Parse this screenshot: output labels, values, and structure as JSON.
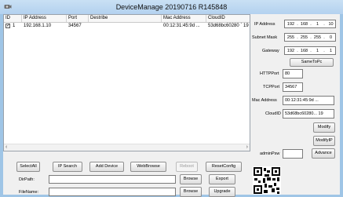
{
  "window": {
    "title": "DeviceManage 20190716 R145848"
  },
  "table": {
    "columns": [
      "ID",
      "IP Address",
      "Port",
      "Destribe",
      "Mac Address",
      "CloudID"
    ],
    "rows": [
      {
        "checked": true,
        "id": "1",
        "ip": "192.168.1.10",
        "port": "34567",
        "describe": "",
        "mac": "00:12:31:45:9d ...",
        "cloud": "53d68bc60280 ` 19"
      }
    ]
  },
  "settings": {
    "ip_label": "IP Address",
    "ip_octets": [
      "192",
      "168",
      "1",
      "10"
    ],
    "mask_label": "Subnet Mask",
    "mask_octets": [
      "255",
      "255",
      "255",
      "0"
    ],
    "gateway_label": "Gateway",
    "gateway_octets": [
      "192",
      "168",
      "1",
      "1"
    ],
    "same_to_pc": "SameToPc",
    "http_port_label": "HTTPPort",
    "http_port": "80",
    "tcp_port_label": "TCPPort",
    "tcp_port": "34567",
    "mac_label": "Mac Address",
    "mac": "00:12:31:45:9d ...",
    "cloud_label": "CloudID",
    "cloud": "53d68bc60280... 19",
    "modify": "Modify",
    "modify_ip": "ModifyIP",
    "admin_label": "adminPsw",
    "admin_value": "",
    "advance": "Advance"
  },
  "toolbar": {
    "select_all": "SelectAll",
    "ip_search": "IP Search",
    "add_device": "Add Device",
    "web_browse": "WebBrowse",
    "reboot": "Reboot",
    "reset_config": "ResetConfig"
  },
  "files": {
    "dir_label": "DirPath:",
    "dir_value": "",
    "file_label": "FileName:",
    "file_value": "",
    "browse": "Browse",
    "export": "Export",
    "upgrade": "Upgrade"
  },
  "icons": {
    "app": "camera-icon",
    "qr": "qr-code"
  },
  "colors": {
    "window_frame": "#9fc5e6",
    "titlebar": "#bcd7f1",
    "panel": "#f0f0f0"
  }
}
